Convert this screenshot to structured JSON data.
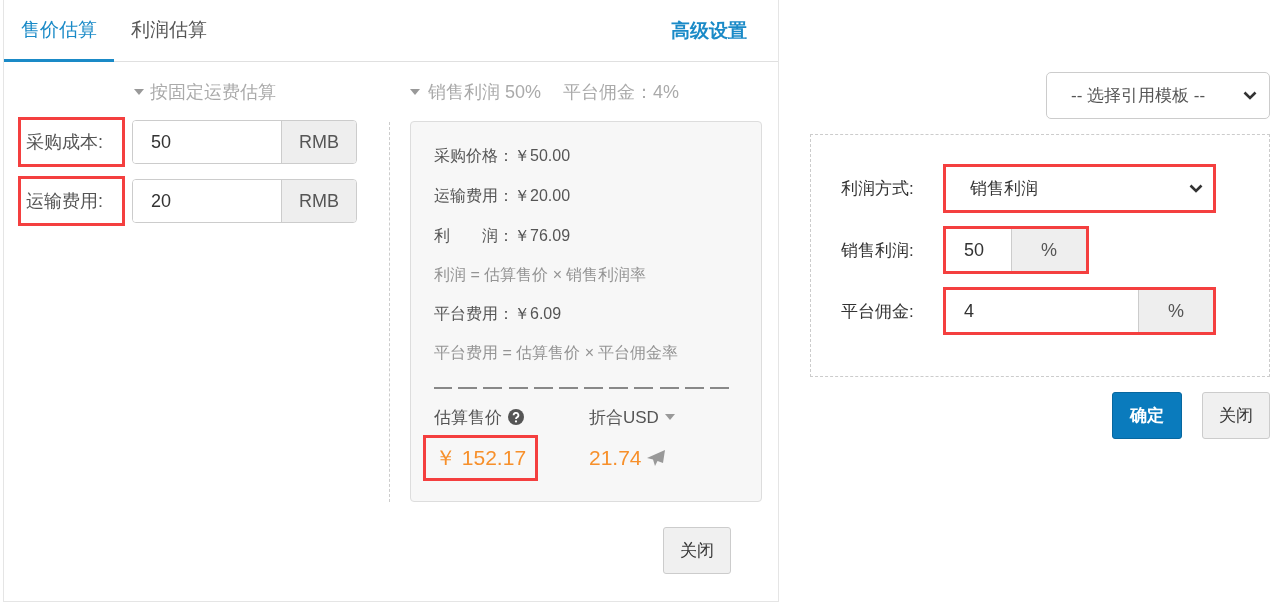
{
  "tabs": [
    {
      "label": "售价估算",
      "selected": true
    },
    {
      "label": "利润估算",
      "selected": false
    }
  ],
  "advanced_link": "高级设置",
  "shipping_mode": "按固定运费估算",
  "summary_caption": {
    "profit": "销售利润 50%",
    "commission": "平台佣金：4%"
  },
  "cost_fields": [
    {
      "label": "采购成本:",
      "value": "50",
      "unit": "RMB",
      "highlighted": true
    },
    {
      "label": "运输费用:",
      "value": "20",
      "unit": "RMB",
      "highlighted": true
    }
  ],
  "summary": {
    "lines": [
      {
        "kind": "value",
        "text": "采购价格：￥50.00"
      },
      {
        "kind": "value",
        "text": "运输费用：￥20.00"
      },
      {
        "kind": "value",
        "text": "利　　润：￥76.09"
      },
      {
        "kind": "formula",
        "text": "利润 = 估算售价 × 销售利润率"
      },
      {
        "kind": "value",
        "text": "平台费用：￥6.09"
      },
      {
        "kind": "formula",
        "text": "平台费用 = 估算售价 × 平台佣金率"
      }
    ],
    "estimated_price": {
      "label": "估算售价",
      "value": "￥ 152.17",
      "highlighted": true
    },
    "converted": {
      "label": "折合USD",
      "value": "21.74"
    }
  },
  "close_button": "关闭",
  "template_select": "-- 选择引用模板 --",
  "settings": [
    {
      "kind": "select",
      "label": "利润方式:",
      "value": "销售利润",
      "highlighted": true
    },
    {
      "kind": "addon",
      "label": "销售利润:",
      "value": "50",
      "unit": "%",
      "highlighted": true
    },
    {
      "kind": "addon",
      "label": "平台佣金:",
      "value": "4",
      "unit": "%",
      "highlighted": true
    }
  ],
  "buttons": [
    {
      "label": "确定",
      "kind": "primary"
    },
    {
      "label": "关闭",
      "kind": "default"
    }
  ]
}
